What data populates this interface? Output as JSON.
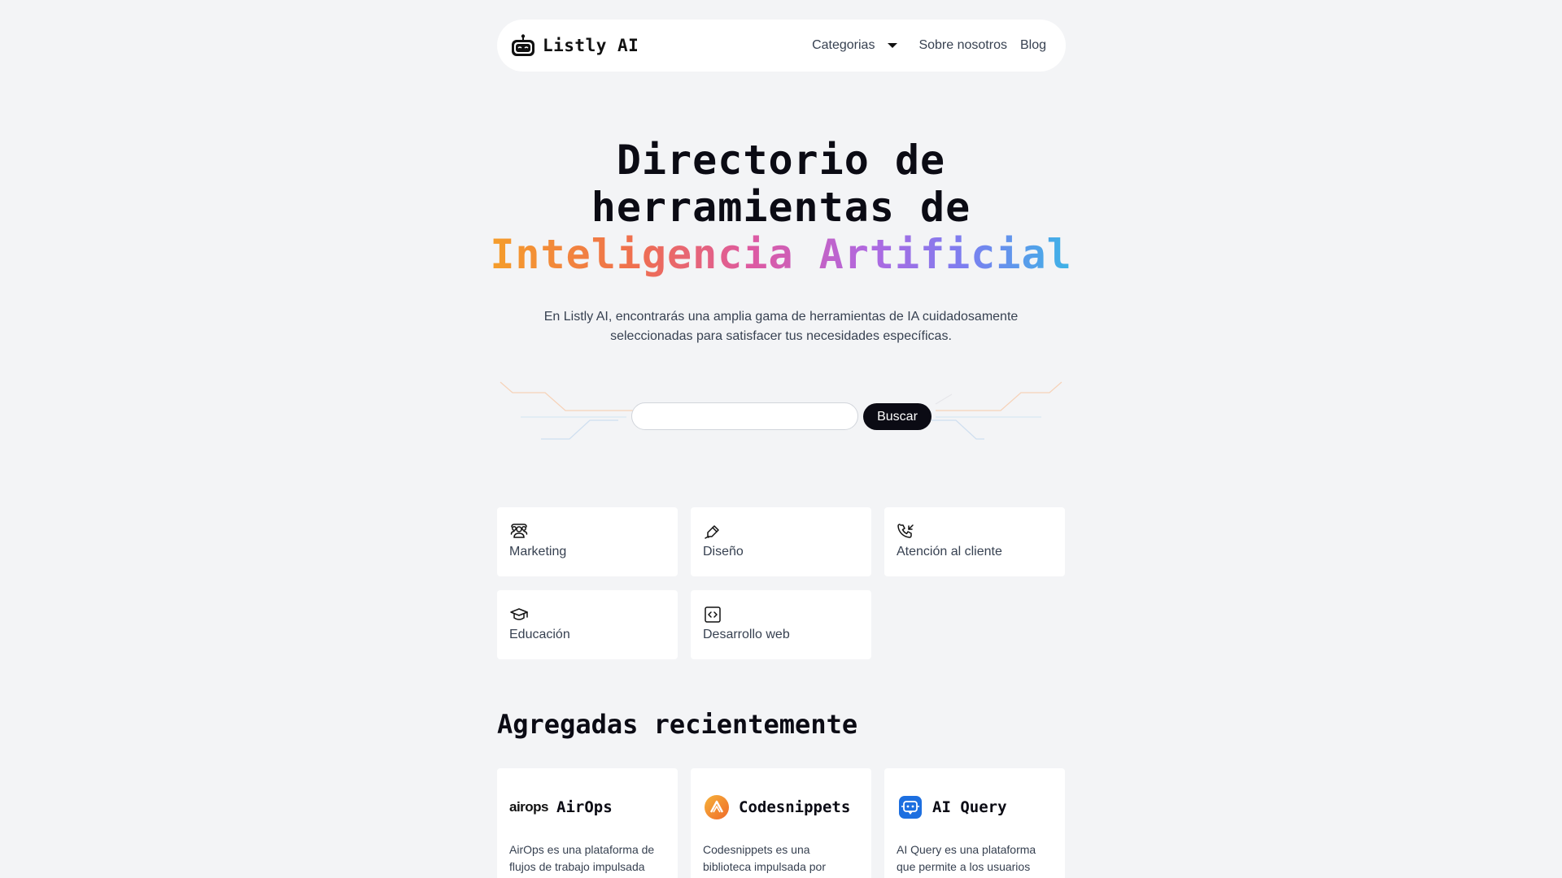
{
  "nav": {
    "brand": "Listly AI",
    "categories_label": "Categorias",
    "about_label": "Sobre nosotros",
    "blog_label": "Blog"
  },
  "hero": {
    "title_line1": "Directorio de",
    "title_line2": "herramientas de",
    "title_highlight": "Inteligencia Artificial",
    "subtitle": "En Listly AI, encontrarás una amplia gama de herramientas de IA cuidadosamente seleccionadas para satisfacer tus necesidades específicas."
  },
  "search": {
    "placeholder": "",
    "button_label": "Buscar"
  },
  "categories": [
    {
      "label": "Marketing",
      "icon": "users-icon"
    },
    {
      "label": "Diseño",
      "icon": "pen-icon"
    },
    {
      "label": "Atención al cliente",
      "icon": "phone-incoming-icon"
    },
    {
      "label": "Educación",
      "icon": "graduation-cap-icon"
    },
    {
      "label": "Desarrollo web",
      "icon": "code-icon"
    }
  ],
  "recent": {
    "title": "Agregadas recientemente",
    "tools": [
      {
        "name": "AirOps",
        "logo_text": "airops",
        "description": "AirOps es una plataforma de flujos de trabajo impulsada"
      },
      {
        "name": "Codesnippets",
        "description": "Codesnippets es una biblioteca impulsada por"
      },
      {
        "name": "AI Query",
        "description": "AI Query es una plataforma que permite a los usuarios"
      }
    ]
  },
  "colors": {
    "background": "#f3f4f6",
    "text_dark": "#0b0b14",
    "gradient": [
      "#f59e2a",
      "#dd5aa2",
      "#b068e0",
      "#3cb4e6"
    ]
  }
}
